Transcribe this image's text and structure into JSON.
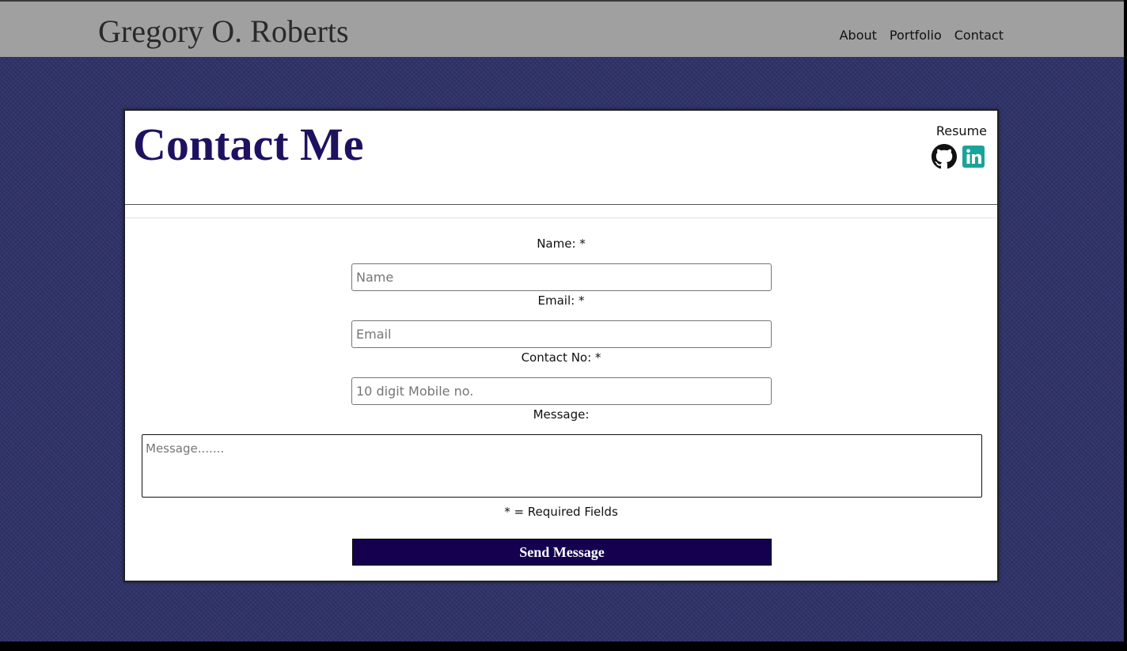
{
  "header": {
    "site_title": "Gregory O. Roberts",
    "nav": [
      {
        "label": "About"
      },
      {
        "label": "Portfolio"
      },
      {
        "label": "Contact"
      }
    ]
  },
  "card": {
    "title": "Contact Me",
    "resume_label": "Resume",
    "social_icons": [
      "github-icon",
      "linkedin-icon"
    ],
    "linkedin_color": "#1aa39a",
    "title_color": "#1e1260"
  },
  "form": {
    "name_label": "Name: *",
    "name_placeholder": "Name",
    "email_label": "Email: *",
    "email_placeholder": "Email",
    "contact_label": "Contact No: *",
    "contact_placeholder": "10 digit Mobile no.",
    "message_label": "Message:",
    "message_placeholder": "Message.......",
    "required_note": "* = Required Fields",
    "submit_label": "Send Message",
    "submit_color": "#14004f"
  }
}
